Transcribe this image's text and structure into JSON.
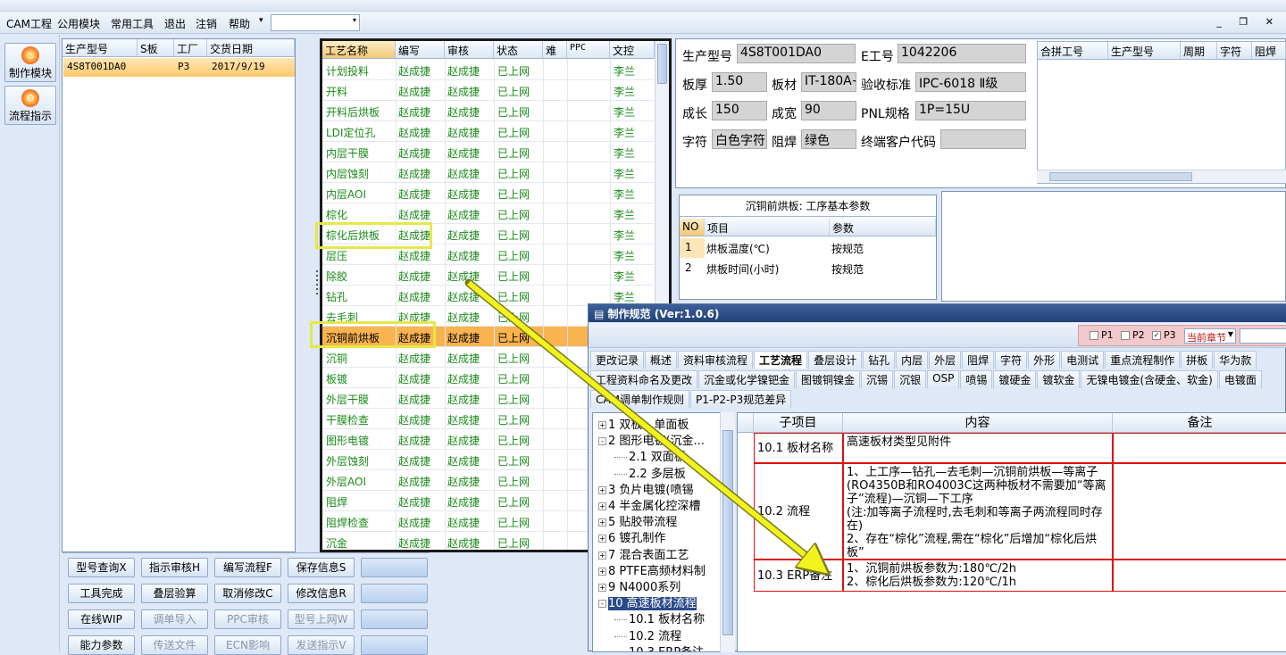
{
  "menubar": {
    "items": [
      "CAM工程",
      "公用模块",
      "常用工具",
      "退出",
      "注销",
      "帮助"
    ],
    "dropdown_arrow": "▾",
    "window_controls": "_ ❐ ✕"
  },
  "sidebar": {
    "buttons": [
      {
        "label": "制作模块",
        "icon": "fire-icon"
      },
      {
        "label": "流程指示",
        "icon": "flow-icon"
      }
    ]
  },
  "project_list": {
    "columns": [
      "生产型号",
      "S板",
      "工厂",
      "交货日期"
    ],
    "rows": [
      [
        "4S8T001DA0",
        "",
        "P3",
        "2017/9/19"
      ]
    ]
  },
  "process_list": {
    "columns": [
      "工艺名称",
      "编写",
      "审核",
      "状态",
      "难",
      "PPC",
      "文控"
    ],
    "rows": [
      [
        "计划投料",
        "赵成捷",
        "赵成捷",
        "已上网",
        "",
        "",
        "李兰"
      ],
      [
        "开料",
        "赵成捷",
        "赵成捷",
        "已上网",
        "",
        "",
        "李兰"
      ],
      [
        "开料后烘板",
        "赵成捷",
        "赵成捷",
        "已上网",
        "",
        "",
        "李兰"
      ],
      [
        "LDI定位孔",
        "赵成捷",
        "赵成捷",
        "已上网",
        "",
        "",
        "李兰"
      ],
      [
        "内层干膜",
        "赵成捷",
        "赵成捷",
        "已上网",
        "",
        "",
        "李兰"
      ],
      [
        "内层蚀刻",
        "赵成捷",
        "赵成捷",
        "已上网",
        "",
        "",
        "李兰"
      ],
      [
        "内层AOI",
        "赵成捷",
        "赵成捷",
        "已上网",
        "",
        "",
        "李兰"
      ],
      [
        "棕化",
        "赵成捷",
        "赵成捷",
        "已上网",
        "",
        "",
        "李兰"
      ],
      [
        "棕化后烘板",
        "赵成捷",
        "赵成捷",
        "已上网",
        "",
        "",
        "李兰"
      ],
      [
        "层压",
        "赵成捷",
        "赵成捷",
        "已上网",
        "",
        "",
        "李兰"
      ],
      [
        "除胶",
        "赵成捷",
        "赵成捷",
        "已上网",
        "",
        "",
        "李兰"
      ],
      [
        "钻孔",
        "赵成捷",
        "赵成捷",
        "已上网",
        "",
        "",
        "李兰"
      ],
      [
        "去毛刺",
        "赵成捷",
        "赵成捷",
        "已上网",
        "",
        "",
        "李兰"
      ],
      [
        "沉铜前烘板",
        "赵成捷",
        "赵成捷",
        "已上网",
        "",
        "",
        ""
      ],
      [
        "沉铜",
        "赵成捷",
        "赵成捷",
        "已上网",
        "",
        "",
        ""
      ],
      [
        "板镀",
        "赵成捷",
        "赵成捷",
        "已上网",
        "",
        "",
        ""
      ],
      [
        "外层干膜",
        "赵成捷",
        "赵成捷",
        "已上网",
        "",
        "",
        ""
      ],
      [
        "干膜检查",
        "赵成捷",
        "赵成捷",
        "已上网",
        "",
        "",
        ""
      ],
      [
        "图形电镀",
        "赵成捷",
        "赵成捷",
        "已上网",
        "",
        "",
        ""
      ],
      [
        "外层蚀刻",
        "赵成捷",
        "赵成捷",
        "已上网",
        "",
        "",
        ""
      ],
      [
        "外层AOI",
        "赵成捷",
        "赵成捷",
        "已上网",
        "",
        "",
        ""
      ],
      [
        "阻焊",
        "赵成捷",
        "赵成捷",
        "已上网",
        "",
        "",
        ""
      ],
      [
        "阻焊检查",
        "赵成捷",
        "赵成捷",
        "已上网",
        "",
        "",
        ""
      ],
      [
        "沉金",
        "赵成捷",
        "赵成捷",
        "已上网",
        "",
        "",
        ""
      ]
    ],
    "selected_index": 13
  },
  "buttons": {
    "rows": [
      [
        {
          "label": "型号查询X",
          "enabled": true
        },
        {
          "label": "指示审核H",
          "enabled": true
        },
        {
          "label": "编写流程F",
          "enabled": true
        },
        {
          "label": "保存信息S",
          "enabled": true
        },
        {
          "label": "",
          "enabled": true
        }
      ],
      [
        {
          "label": "工具完成",
          "enabled": true
        },
        {
          "label": "叠层验算",
          "enabled": true
        },
        {
          "label": "取消修改C",
          "enabled": true
        },
        {
          "label": "修改信息R",
          "enabled": true
        },
        {
          "label": "",
          "enabled": true
        }
      ],
      [
        {
          "label": "在线WIP",
          "enabled": true
        },
        {
          "label": "调单导入",
          "enabled": false
        },
        {
          "label": "PPC审核",
          "enabled": false
        },
        {
          "label": "型号上网W",
          "enabled": false
        },
        {
          "label": "",
          "enabled": true
        }
      ],
      [
        {
          "label": "能力参数",
          "enabled": true
        },
        {
          "label": "传送文件",
          "enabled": false
        },
        {
          "label": "ECN影响",
          "enabled": false
        },
        {
          "label": "发送指示V",
          "enabled": false
        },
        {
          "label": "",
          "enabled": true
        }
      ]
    ]
  },
  "info": {
    "production_model_label": "生产型号",
    "production_model": "4S8T001DA0",
    "e_no_label": "E工号",
    "e_no": "1042206",
    "thickness_label": "板厚",
    "thickness": "1.50",
    "material_label": "板材",
    "material": "IT-180A+",
    "standard_label": "验收标准",
    "standard": "IPC-6018 Ⅱ级",
    "length_label": "成长",
    "length": "150",
    "width_label": "成宽",
    "width": "90",
    "pnl_label": "PNL规格",
    "pnl": "1P=15U",
    "legend_label": "字符",
    "legend": "白色字符",
    "mask_label": "阻焊",
    "mask": "绿色",
    "customer_label": "终端客户代码",
    "customer": ""
  },
  "combined_grid": {
    "columns": [
      "合拼工号",
      "生产型号",
      "周期",
      "字符",
      "阻焊"
    ]
  },
  "params": {
    "title": "沉铜前烘板: 工序基本参数",
    "columns": [
      "NO",
      "项目",
      "参数"
    ],
    "rows": [
      [
        "1",
        "烘板温度(℃)",
        "按规范"
      ],
      [
        "2",
        "烘板时间(小时)",
        "按规范"
      ]
    ]
  },
  "dialog": {
    "title": "制作规范 (Ver:1.0.6)",
    "checks": [
      {
        "label": "P1",
        "checked": false
      },
      {
        "label": "P2",
        "checked": false
      },
      {
        "label": "P3",
        "checked": true
      }
    ],
    "chapter_select": "当前章节",
    "tabs_row1": [
      "更改记录",
      "概述",
      "资料审核流程",
      "工艺流程",
      "叠层设计",
      "钻孔",
      "内层",
      "外层",
      "阻焊",
      "字符",
      "外形",
      "电测试",
      "重点流程制作",
      "拼板",
      "华为款"
    ],
    "tabs_row2": [
      "工程资料命名及更改",
      "沉金或化学镍钯金",
      "图镀铜镍金",
      "沉锡",
      "沉银",
      "OSP",
      "喷锡",
      "镀硬金",
      "镀软金",
      "无镍电镀金(含硬金、软金)",
      "电镀面"
    ],
    "tabs_row3": [
      "CAM调单制作规则",
      "P1-P2-P3规范差异"
    ],
    "active_tab": "工艺流程",
    "tree": [
      {
        "label": "1 双板、单面板",
        "level": 0,
        "box": "+"
      },
      {
        "label": "2 图形电镀(沉金...",
        "level": 0,
        "box": "-"
      },
      {
        "label": "2.1 双面板",
        "level": 1
      },
      {
        "label": "2.2 多层板",
        "level": 1
      },
      {
        "label": "3 负片电镀(喷锡",
        "level": 0,
        "box": "+"
      },
      {
        "label": "4 半金属化控深槽",
        "level": 0,
        "box": "+"
      },
      {
        "label": "5 贴胶带流程",
        "level": 0,
        "box": "+"
      },
      {
        "label": "6 镀孔制作",
        "level": 0,
        "box": "+"
      },
      {
        "label": "7 混合表面工艺",
        "level": 0,
        "box": "+"
      },
      {
        "label": "8 PTFE高频材料制",
        "level": 0,
        "box": "+"
      },
      {
        "label": "9 N4000系列",
        "level": 0,
        "box": "+"
      },
      {
        "label": "10 高速板材流程",
        "level": 0,
        "box": "-",
        "selected": true
      },
      {
        "label": "10.1 板材名称",
        "level": 1
      },
      {
        "label": "10.2 流程",
        "level": 1
      },
      {
        "label": "10.3 ERP备注",
        "level": 1
      }
    ],
    "content_columns": [
      "",
      "子项目",
      "内容",
      "备注"
    ],
    "content_rows": [
      {
        "sub": "10.1 板材名称",
        "content": "高速板材类型见附件",
        "note": ""
      },
      {
        "sub": "10.2 流程",
        "content": "1、上工序—钻孔—去毛刺—沉铜前烘板—等离子(RO4350B和RO4003C这两种板材不需要加“等离子”流程)—沉铜—下工序\n(注:加等离子流程时,去毛刺和等离子两流程同时存在)\n2、存在“棕化”流程,需在“棕化”后增加“棕化后烘板”",
        "note": ""
      },
      {
        "sub": "10.3 ERP备注",
        "content": "1、沉铜前烘板参数为:180℃/2h\n2、棕化后烘板参数为:120℃/1h",
        "note": ""
      }
    ]
  },
  "colors": {
    "highlight_box": "#e5e84a",
    "arrow": "#f2f21e",
    "selected_row": "#f9b34f",
    "green_text": "#1a8a1a",
    "dialog_title": "#23427a",
    "red_grid": "#e01010"
  }
}
